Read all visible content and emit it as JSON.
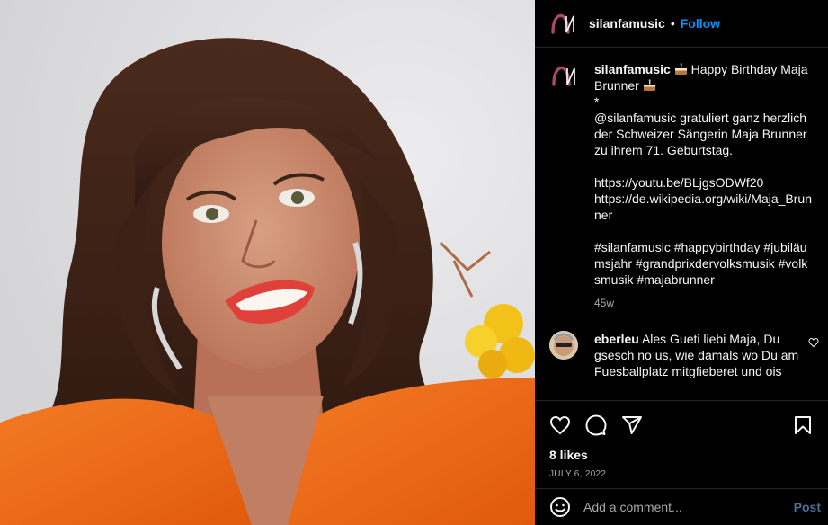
{
  "account": {
    "handle": "silanfamusic",
    "follow_label": "Follow",
    "separator": "•"
  },
  "caption": {
    "username": "silanfamusic",
    "title_part1": "Happy Birthday Maja Brunner",
    "text": "*\n@silanfamusic gratuliert ganz herzlich der Schweizer Sängerin Maja Brunner zu ihrem 71. Geburtstag.\n\nhttps://youtu.be/BLjgsODWf20\nhttps://de.wikipedia.org/wiki/Maja_Brunner\n\n#silanfamusic #happybirthday #jubiläumsjahr #grandprixdervolksmusik #volksmusik #majabrunner",
    "age": "45w",
    "emoji": "cake"
  },
  "comment": {
    "username": "eberleu",
    "text": "Ales Gueti liebi Maja, Du gsesch no us, wie damals wo Du am Fuesballplatz mitgfieberet und ois"
  },
  "stats": {
    "likes": "8 likes",
    "date": "JULY 6, 2022"
  },
  "composer": {
    "placeholder": "Add a comment...",
    "post_label": "Post"
  },
  "colors": {
    "accent": "#0095f6",
    "logo": "#a8466b",
    "photo_blouse": "#f36b16"
  },
  "icons": [
    "logo-icon",
    "heart-icon",
    "comment-icon",
    "share-icon",
    "bookmark-icon",
    "emoji-icon",
    "small-heart-icon",
    "cake-icon"
  ]
}
